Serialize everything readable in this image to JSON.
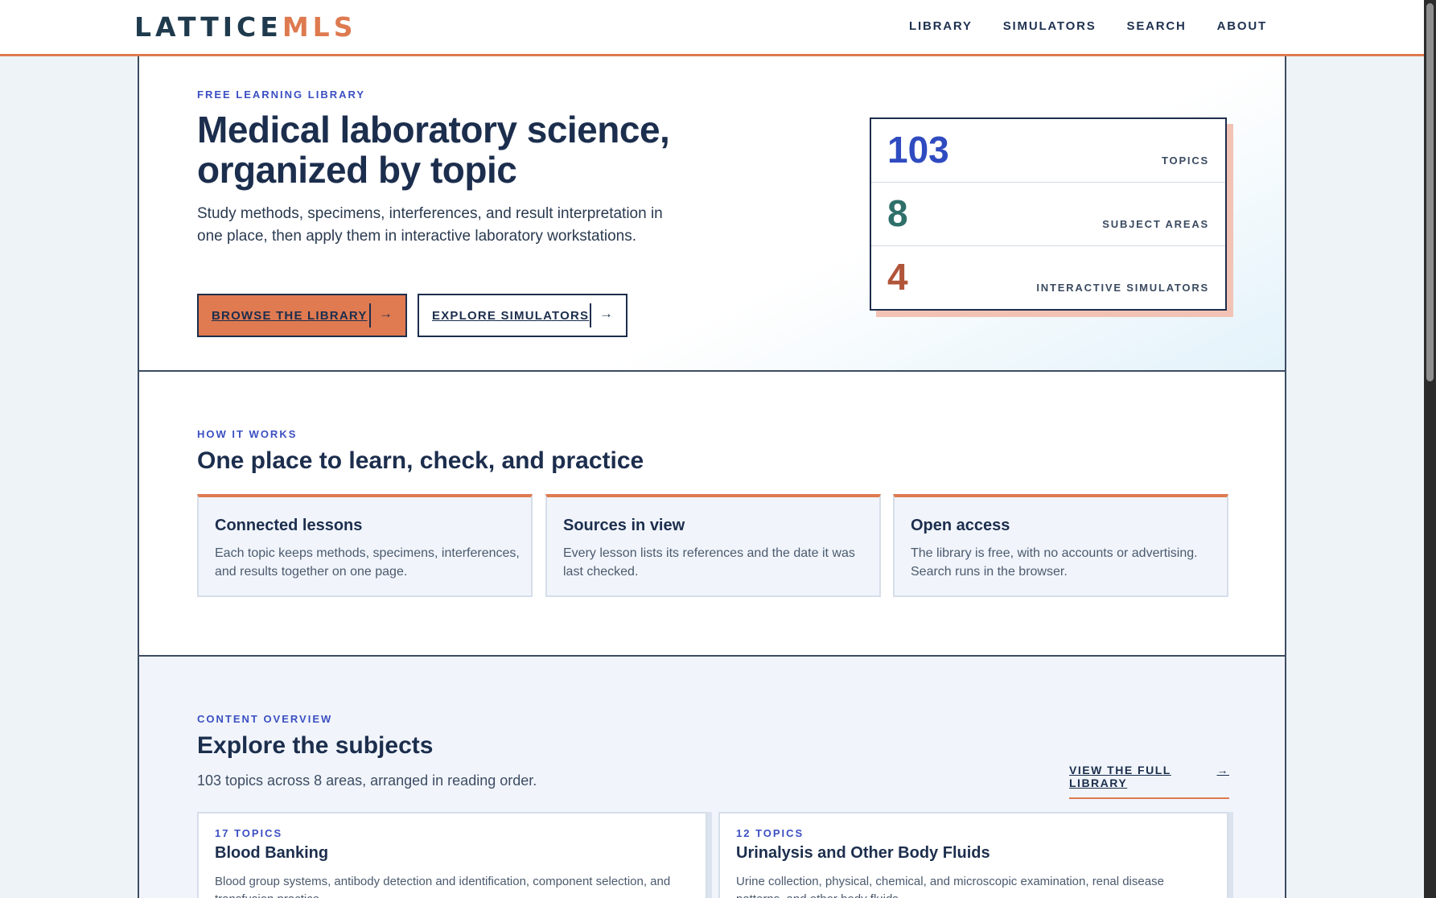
{
  "brand": {
    "logo_part1": "LATTICE",
    "logo_part2": "MLS",
    "accent": "#de7a50"
  },
  "nav": [
    "LIBRARY",
    "SIMULATORS",
    "SEARCH",
    "ABOUT"
  ],
  "hero": {
    "eyebrow": "FREE LEARNING LIBRARY",
    "title": "Medical laboratory science, organized by topic",
    "description": "Study methods, specimens, interferences, and result interpretation in one place, then apply them in interactive laboratory workstations.",
    "primary_button": "BROWSE THE LIBRARY",
    "secondary_button": "EXPLORE SIMULATORS",
    "button_arrow": "→",
    "stats": [
      {
        "value": "103",
        "label": "TOPICS",
        "color": "#2f4bc0"
      },
      {
        "value": "8",
        "label": "SUBJECT AREAS",
        "color": "#2f6f6a"
      },
      {
        "value": "4",
        "label": "INTERACTIVE SIMULATORS",
        "color": "#b0553a"
      }
    ]
  },
  "how": {
    "eyebrow": "HOW IT WORKS",
    "title": "One place to learn, check, and practice",
    "cards": [
      {
        "title": "Connected lessons",
        "text": "Each topic keeps methods, specimens, interferences, and results together on one page."
      },
      {
        "title": "Sources in view",
        "text": "Every lesson lists its references and the date it was last checked."
      },
      {
        "title": "Open access",
        "text": "The library is free, with no accounts or advertising. Search runs in the browser."
      }
    ]
  },
  "explore": {
    "eyebrow": "CONTENT OVERVIEW",
    "title": "Explore the subjects",
    "description": "103 topics across 8 areas, arranged in reading order.",
    "view_all": "VIEW THE FULL LIBRARY",
    "view_all_arrow": "→",
    "subjects": [
      {
        "count": "17 TOPICS",
        "title": "Blood Banking",
        "text": "Blood group systems, antibody detection and identification, component selection, and transfusion practice."
      },
      {
        "count": "12 TOPICS",
        "title": "Urinalysis and Other Body Fluids",
        "text": "Urine collection, physical, chemical, and microscopic examination, renal disease patterns, and other body fluids."
      }
    ]
  }
}
